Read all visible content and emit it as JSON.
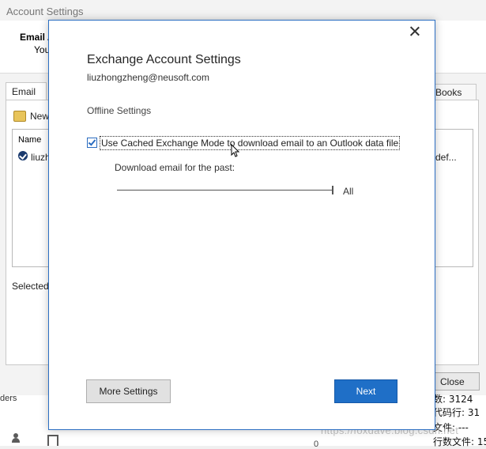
{
  "background_window": {
    "title": "Account Settings",
    "email_heading": "Email A",
    "email_desc": "You",
    "tab_email": "Email",
    "tab_right": "Books",
    "new_label": "New",
    "column_name": "Name",
    "account_name": "liuzh",
    "account_trunc": "def...",
    "selected_label": "Selected",
    "close_label": "Close"
  },
  "outlook_strip": {
    "folders_fragment": "ders",
    "q_fragment": "0",
    "cn_lines": [
      "数: 3124",
      "代码行: 31",
      "文件: ---",
      "行数文件: 15"
    ]
  },
  "watermark": "https://foxdave.blog.csdn.net",
  "dialog": {
    "title": "Exchange Account Settings",
    "email": "liuzhongzheng@neusoft.com",
    "section": "Offline Settings",
    "cached_mode_label": "Use Cached Exchange Mode to download email to an Outlook data file",
    "cached_mode_checked": true,
    "download_label": "Download email for the past:",
    "slider_value": "All",
    "slider_level": 1.0,
    "more_settings": "More Settings",
    "next": "Next"
  },
  "icons": {
    "close": "close-icon",
    "checkbox": "checkbox-checked",
    "account": "account-check-icon",
    "new": "new-mail-icon",
    "people": "people-icon",
    "calendar": "calendar-icon",
    "cursor": "mouse-cursor-icon"
  },
  "colors": {
    "accent": "#1f6fc7",
    "dialog_border": "#2b6ec2"
  }
}
